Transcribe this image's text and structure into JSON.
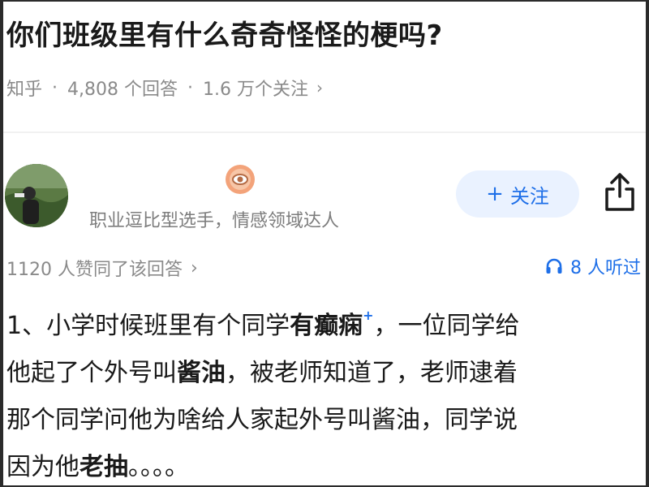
{
  "question": {
    "title": "你们班级里有什么奇奇怪怪的梗吗?",
    "meta": {
      "source": "知乎",
      "sep": "·",
      "answers": "4,808 个回答",
      "followers": "1.6 万个关注",
      "chevron": "›"
    }
  },
  "author": {
    "description": "职业逗比型选手，情感领域达人",
    "follow_label": "关注",
    "follow_plus": "+"
  },
  "answer": {
    "votes": "1120 人赞同了该回答",
    "votes_chevron": "›",
    "listened": "8 人听过",
    "lines": {
      "l1a": "1、小学时候班里有个同学",
      "l1b": "有",
      "l1c": "癫痫",
      "l1sup": "+",
      "l1d": "，一位同学给",
      "l2a": "他起了个外号叫",
      "l2b": "酱油",
      "l2c": "，被老师知道了，老师逮着",
      "l3": "那个同学问他为啥给人家起外号叫酱油，同学说",
      "l4a": "因为他",
      "l4b": "老抽",
      "l4c": "。。。。"
    }
  },
  "colors": {
    "accent": "#1e6fe8",
    "follow_bg": "#eaf2ff",
    "text": "#1a1a1a",
    "muted": "#8a8a8a"
  },
  "icons": {
    "share": "share-icon",
    "headphones": "headphones-icon",
    "badge": "eye-badge-icon"
  }
}
